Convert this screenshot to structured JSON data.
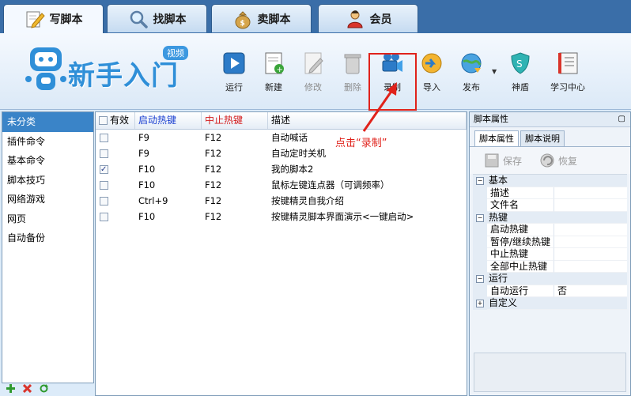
{
  "tabs": [
    {
      "label": "写脚本",
      "icon": "pencil-paper-icon"
    },
    {
      "label": "找脚本",
      "icon": "magnifier-icon"
    },
    {
      "label": "卖脚本",
      "icon": "money-bag-icon"
    },
    {
      "label": "会员",
      "icon": "members-icon"
    }
  ],
  "logo": {
    "text": "新手入门",
    "badge": "视频"
  },
  "toolbar": {
    "run": "运行",
    "new": "新建",
    "edit": "修改",
    "delete": "删除",
    "record": "录制",
    "import": "导入",
    "publish": "发布",
    "shield": "神盾",
    "learn": "学习中心"
  },
  "categories": [
    "未分类",
    "插件命令",
    "基本命令",
    "脚本技巧",
    "网络游戏",
    "网页",
    "自动备份"
  ],
  "table": {
    "headers": {
      "enabled": "有效",
      "start_hotkey": "启动热键",
      "stop_hotkey": "中止热键",
      "desc": "描述"
    },
    "rows": [
      {
        "checked": false,
        "start": "F9",
        "stop": "F12",
        "desc": "自动喊话"
      },
      {
        "checked": false,
        "start": "F9",
        "stop": "F12",
        "desc": "自动定时关机"
      },
      {
        "checked": true,
        "start": "F10",
        "stop": "F12",
        "desc": "我的脚本2"
      },
      {
        "checked": false,
        "start": "F10",
        "stop": "F12",
        "desc": "鼠标左键连点器（可调频率）"
      },
      {
        "checked": false,
        "start": "Ctrl+9",
        "stop": "F12",
        "desc": "按键精灵自我介绍"
      },
      {
        "checked": false,
        "start": "F10",
        "stop": "F12",
        "desc": "按键精灵脚本界面演示<一键启动>"
      }
    ]
  },
  "annotation": "点击“录制”",
  "right_panel": {
    "title": "脚本属性",
    "pin": "ᵖ",
    "tabs": [
      "脚本属性",
      "脚本说明"
    ],
    "save": "保存",
    "restore": "恢复",
    "groups": {
      "basic": "基本",
      "desc": "描述",
      "filename": "文件名",
      "hotkey": "热键",
      "start_hotkey": "启动热键",
      "pause_hotkey": "暂停/继续热键",
      "stop_hotkey": "中止热键",
      "stop_all_hotkey": "全部中止热键",
      "run": "运行",
      "auto_run": "自动运行",
      "auto_run_value": "否",
      "custom": "自定义"
    }
  }
}
